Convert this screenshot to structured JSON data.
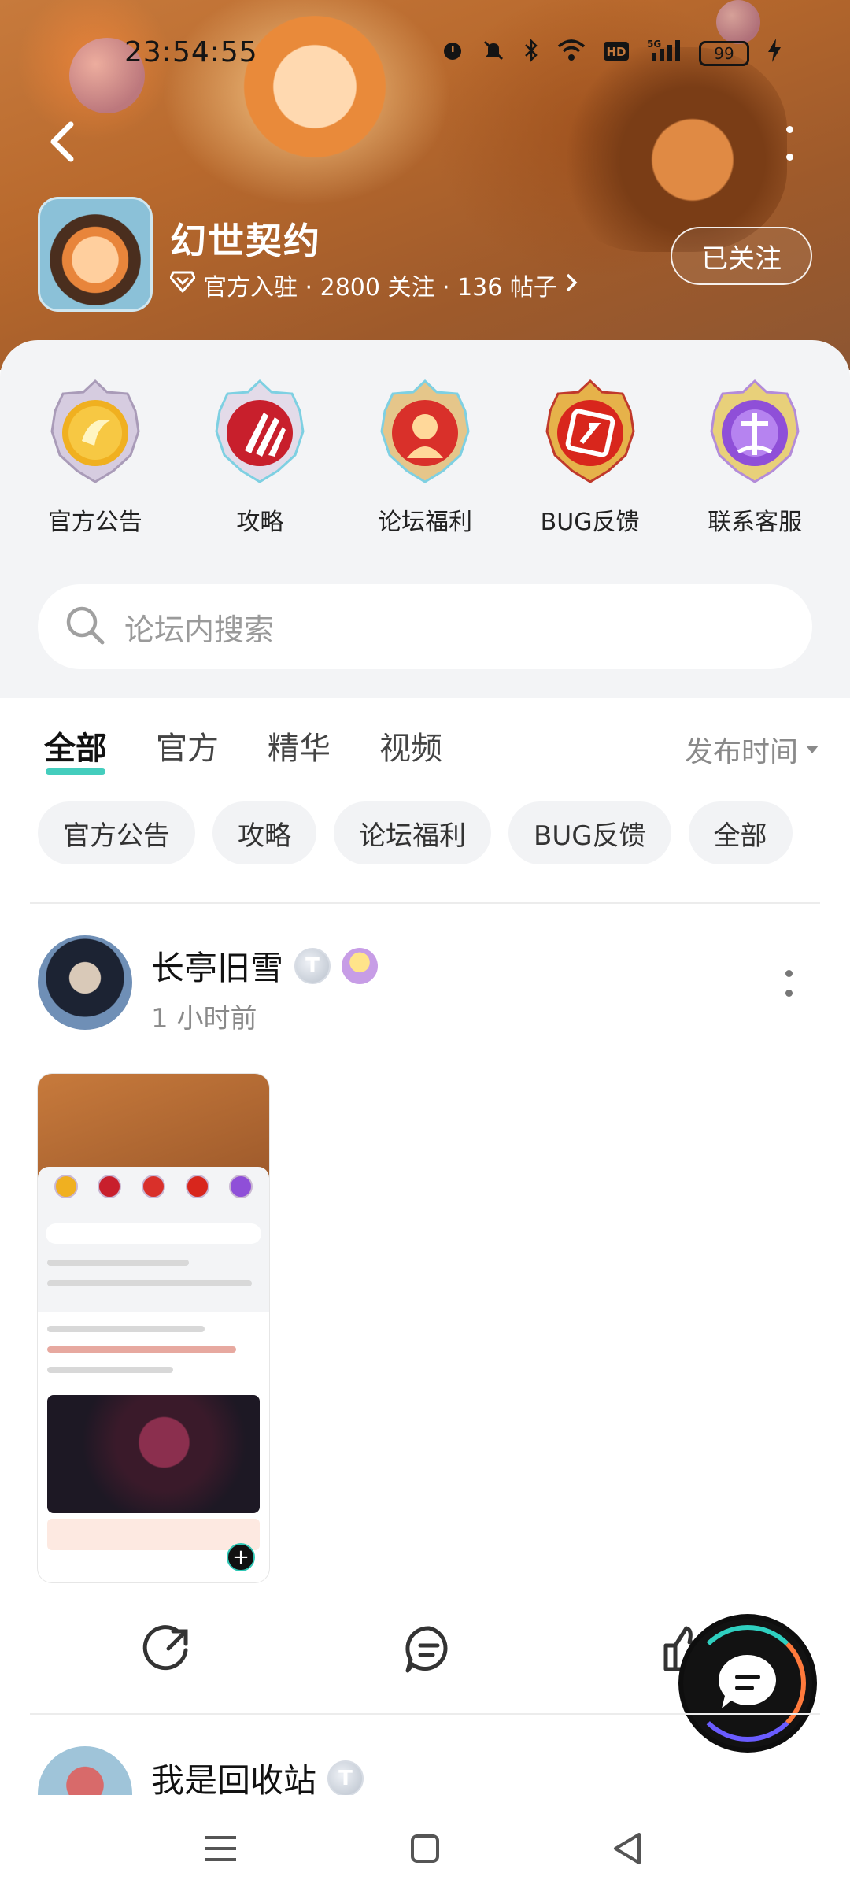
{
  "status_bar": {
    "time": "23:54:55",
    "icons": [
      "alarm-icon",
      "mute-icon",
      "bluetooth-icon",
      "wifi-icon",
      "hd-icon",
      "5g-signal-icon"
    ],
    "battery": "99"
  },
  "forum": {
    "name": "幻世契约",
    "meta": "官方入驻 · 2800 关注 · 136 帖子",
    "follow_label": "已关注"
  },
  "quick_links": [
    {
      "label": "官方公告",
      "icon": "announcement-badge-icon",
      "color": "#f0b020"
    },
    {
      "label": "攻略",
      "icon": "guide-badge-icon",
      "color": "#e23b3b"
    },
    {
      "label": "论坛福利",
      "icon": "welfare-badge-icon",
      "color": "#e0402c"
    },
    {
      "label": "BUG反馈",
      "icon": "bug-report-badge-icon",
      "color": "#e24a1e"
    },
    {
      "label": "联系客服",
      "icon": "customer-service-badge-icon",
      "color": "#9a5ee0"
    }
  ],
  "search": {
    "placeholder": "论坛内搜索"
  },
  "tabs": [
    {
      "label": "全部",
      "active": true
    },
    {
      "label": "官方",
      "active": false
    },
    {
      "label": "精华",
      "active": false
    },
    {
      "label": "视频",
      "active": false
    }
  ],
  "sort_label": "发布时间",
  "chips": [
    "官方公告",
    "攻略",
    "论坛福利",
    "BUG反馈",
    "全部"
  ],
  "posts": [
    {
      "author": "长亭旧雪",
      "level": "T",
      "time": "1 小时前"
    },
    {
      "author": "我是回收站",
      "level": "T"
    }
  ],
  "colors": {
    "accent": "#30c8b6",
    "hero": "#b8692d",
    "panel": "#f3f4f6"
  }
}
